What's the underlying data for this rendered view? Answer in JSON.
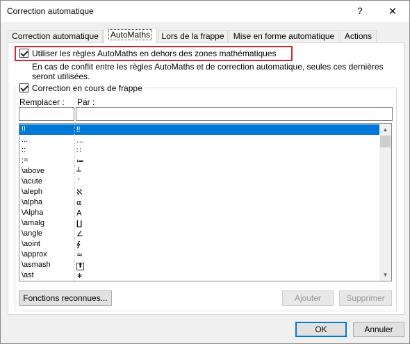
{
  "window": {
    "title": "Correction automatique",
    "help": "?",
    "close": "✕"
  },
  "tabs": [
    {
      "label": "Correction automatique"
    },
    {
      "label": "AutoMaths"
    },
    {
      "label": "Lors de la frappe"
    },
    {
      "label": "Mise en forme automatique"
    },
    {
      "label": "Actions"
    }
  ],
  "options": {
    "use_rules_label": "Utiliser les règles AutoMaths en dehors des zones mathématiques",
    "note": "En cas de conflit entre les règles AutoMaths et de correction automatique, seules ces dernières seront utilisées.",
    "correct_typing_label": "Correction en cours de frappe"
  },
  "fields": {
    "replace_label": "Remplacer :",
    "by_label": "Par :",
    "replace_value": "",
    "by_value": ""
  },
  "list": {
    "rows": [
      {
        "name": "!!",
        "symbol": "‼"
      },
      {
        "name": "...",
        "symbol": "…"
      },
      {
        "name": "::",
        "symbol": "∷"
      },
      {
        "name": ":=",
        "symbol": "≔"
      },
      {
        "name": "\\above",
        "symbol": "┴"
      },
      {
        "name": "\\acute",
        "symbol": "´"
      },
      {
        "name": "\\aleph",
        "symbol": "ℵ"
      },
      {
        "name": "\\alpha",
        "symbol": "α"
      },
      {
        "name": "\\Alpha",
        "symbol": "A"
      },
      {
        "name": "\\amalg",
        "symbol": "∐"
      },
      {
        "name": "\\angle",
        "symbol": "∠"
      },
      {
        "name": "\\aoint",
        "symbol": "∳"
      },
      {
        "name": "\\approx",
        "symbol": "≈"
      },
      {
        "name": "\\asmash",
        "symbol": "⬆"
      },
      {
        "name": "\\ast",
        "symbol": "∗"
      }
    ],
    "selected_index": 0
  },
  "buttons": {
    "functions": "Fonctions reconnues...",
    "add": "Ajouter",
    "remove": "Supprimer",
    "ok": "OK",
    "cancel": "Annuler"
  }
}
